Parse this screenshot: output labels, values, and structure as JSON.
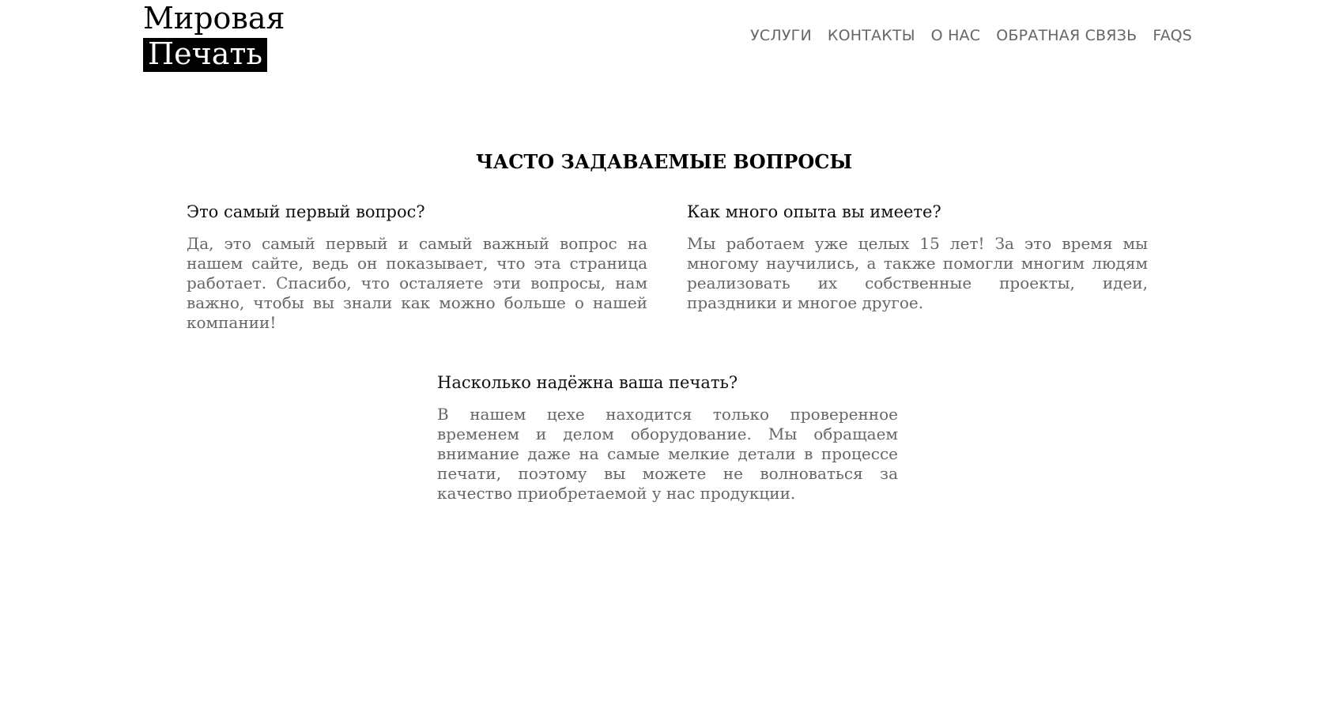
{
  "logo": {
    "line1": "Мировая",
    "line2": "Печать"
  },
  "nav": {
    "items": [
      "УСЛУГИ",
      "КОНТАКТЫ",
      "О НАС",
      "ОБРАТНАЯ СВЯЗЬ",
      "FAQS"
    ]
  },
  "faq": {
    "title": "ЧАСТО ЗАДАВАЕМЫЕ ВОПРОСЫ",
    "items": [
      {
        "question": "Это самый первый вопрос?",
        "answer": "Да, это самый первый и самый важный вопрос на нашем сайте, ведь он показывает, что эта страница работает. Спасибо, что осталяете эти вопросы, нам важно, чтобы вы знали как можно больше о нашей компании!"
      },
      {
        "question": "Как много опыта вы имеете?",
        "answer": "Мы работаем уже целых 15 лет! За это время мы многому научились, а также помогли многим людям реализовать их собственные проекты, идеи, праздники и многое другое."
      },
      {
        "question": "Насколько надёжна ваша печать?",
        "answer": "В нашем цехе находится только проверенное временем и делом оборудование. Мы обращаем внимание даже на самые мелкие детали в процессе печати, поэтому вы можете не волноваться за качество приобретаемой у нас продукции."
      }
    ]
  }
}
